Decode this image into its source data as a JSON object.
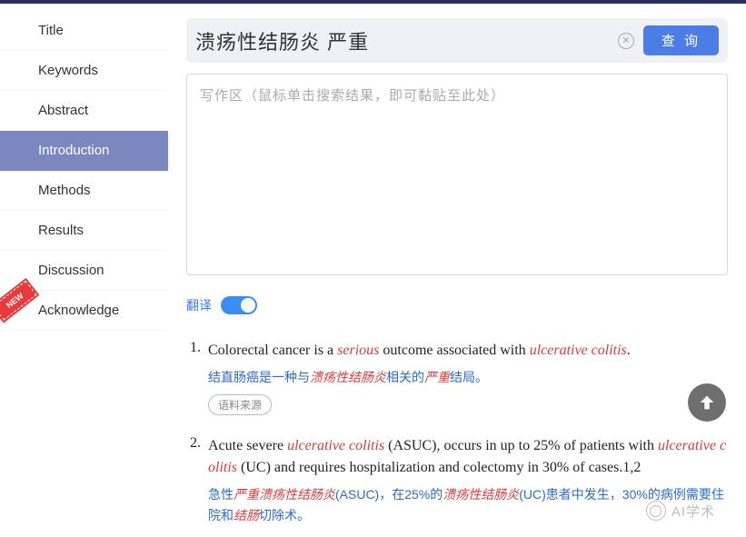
{
  "sidebar": {
    "items": [
      {
        "label": "Title"
      },
      {
        "label": "Keywords"
      },
      {
        "label": "Abstract"
      },
      {
        "label": "Introduction"
      },
      {
        "label": "Methods"
      },
      {
        "label": "Results"
      },
      {
        "label": "Discussion"
      },
      {
        "label": "Acknowledge"
      }
    ],
    "activeIndex": 3,
    "newBadge": "NEW"
  },
  "search": {
    "value": "溃疡性结肠炎 严重",
    "buttonLabel": "查 询"
  },
  "writingArea": {
    "placeholder": "写作区（鼠标单击搜索结果，即可黏贴至此处）"
  },
  "translate": {
    "label": "翻译",
    "on": true
  },
  "results": [
    {
      "num": "1.",
      "english_pre": "Colorectal cancer is a ",
      "english_hl1": "serious",
      "english_mid": " outcome associated with ",
      "english_hl2": "ulcerative colitis",
      "english_post": ".",
      "chinese_pre": "结直肠癌是一种与",
      "chinese_hl1": "溃疡性结肠炎",
      "chinese_mid": "相关的",
      "chinese_hl2": "严重",
      "chinese_post": "结局。",
      "sourceTag": "语料来源"
    },
    {
      "num": "2.",
      "english_pre": "Acute severe ",
      "english_hl1": "ulcerative colitis",
      "english_mid": " (ASUC), occurs in up to 25% of patients with ",
      "english_hl2": "ulcerative colitis",
      "english_post": " (UC) and requires hospitalization and colectomy in 30% of cases.1,2",
      "chinese_pre": "急性",
      "chinese_hl1": "严重溃疡性结肠炎",
      "chinese_mid": "(ASUC)，在25%的",
      "chinese_hl2": "溃疡性结肠炎",
      "chinese_mid2": "(UC)患者中发生，30%的病例需要住院和",
      "chinese_hl3": "结肠",
      "chinese_post": "切除术。"
    }
  ],
  "watermark": "AI学术"
}
